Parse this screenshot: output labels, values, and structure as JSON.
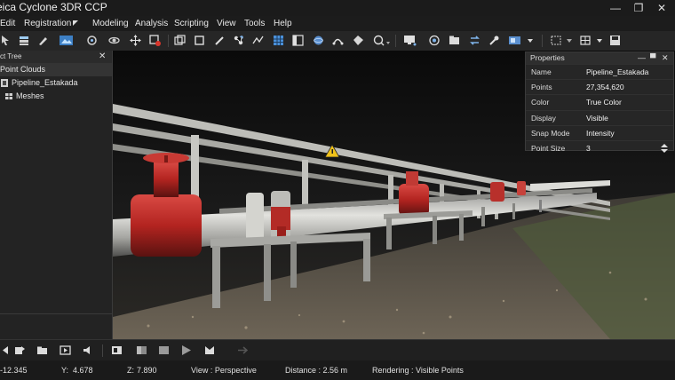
{
  "window": {
    "title": "eica Cyclone 3DR CCP",
    "controls": [
      "minimize-icon",
      "restore-icon",
      "close-icon"
    ]
  },
  "menu": {
    "items": [
      "Edit",
      "Registration",
      "Modeling",
      "Analysis",
      "Scripting",
      "View",
      "Tools",
      "Help"
    ]
  },
  "toolbar": {
    "icons": [
      "pointer-icon",
      "layers-icon",
      "brush-icon",
      "image-icon",
      "rotate-icon",
      "orbit-icon",
      "move-icon",
      "delete-icon",
      "duplicate-icon",
      "frame-icon",
      "pen-icon",
      "molecule-icon",
      "polyline-icon",
      "grid-icon",
      "panel-icon",
      "sphere-icon",
      "align-icon",
      "transform-icon",
      "eraser-icon",
      "probe-icon",
      "monitor-icon",
      "camera-icon",
      "folder-icon",
      "refresh-icon",
      "tools-icon",
      "display-icon",
      "selection-icon",
      "table-icon",
      "save-icon"
    ]
  },
  "object_tree": {
    "title": "ct Tree",
    "close_icon": "close-icon",
    "category": "Point Clouds",
    "items": [
      {
        "label": "Pipeline_Estakada",
        "icon": "point-cloud-icon"
      },
      {
        "label": "Meshes",
        "icon": "mesh-icon"
      }
    ]
  },
  "properties": {
    "title": "Properties",
    "rows": [
      {
        "name": "Name",
        "value": "Pipeline_Estakada"
      },
      {
        "name": "Points",
        "value": "27,354,620"
      },
      {
        "name": "Color",
        "value": "True Color"
      },
      {
        "name": "Display",
        "value": "Visible"
      },
      {
        "name": "Snap Mode",
        "value": "Intensity"
      },
      {
        "name": "Point Size",
        "value": "3"
      }
    ]
  },
  "playback": {
    "icons": [
      "skip-back-icon",
      "folder-icon",
      "step-icon",
      "volume-icon",
      "export-icon",
      "frame-back-icon",
      "stop-icon",
      "play-icon",
      "record-icon",
      "forward-icon"
    ]
  },
  "status": {
    "x": "-12.345",
    "y_label": "Y:",
    "y": "4.678",
    "z_label": "Z:",
    "z": "7.890",
    "view": "View : Perspective",
    "distance": "Distance : 2.56 m",
    "rendering": "Rendering : Visible Points"
  },
  "colors": {
    "accent": "#4a90d9",
    "pipe_red": "#b22222",
    "background": "#1e1e1e"
  }
}
